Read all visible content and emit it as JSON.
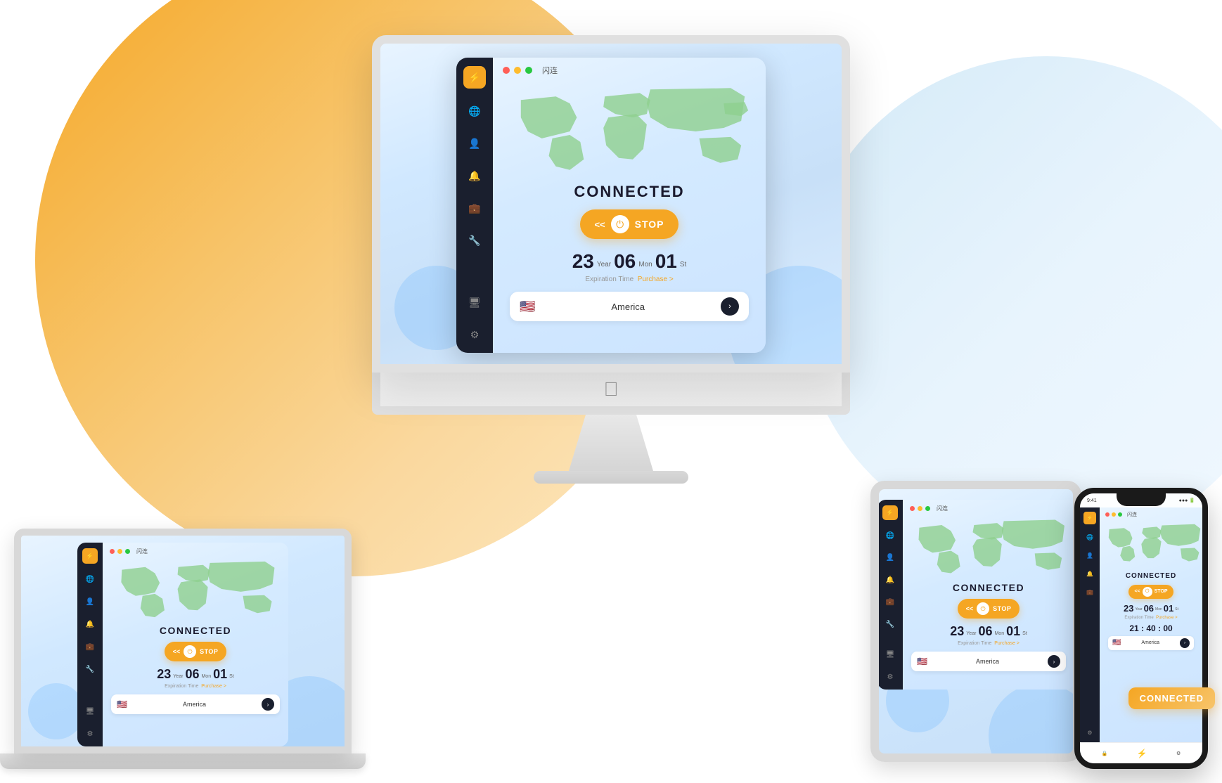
{
  "background": {
    "circle_color": "#f5a623",
    "circle_right_color": "#d4eaff"
  },
  "app": {
    "name": "闪连",
    "status": "CONNECTED",
    "stop_label": "STOP",
    "expiry": {
      "year": "23",
      "year_label": "Year",
      "month": "06",
      "month_label": "Mon",
      "day": "01",
      "day_label": "St"
    },
    "expiry_caption": "Expiration Time",
    "purchase_label": "Purchase >",
    "region": "America",
    "timer": "21 : 40 : 00",
    "chevrons": "<<"
  },
  "devices": {
    "desktop": "iMac",
    "laptop": "MacBook",
    "tablet": "iPad",
    "phone": "iPhone"
  },
  "phone_status_bar": {
    "time": "9:41",
    "signal": "●●●",
    "battery": "▌"
  }
}
